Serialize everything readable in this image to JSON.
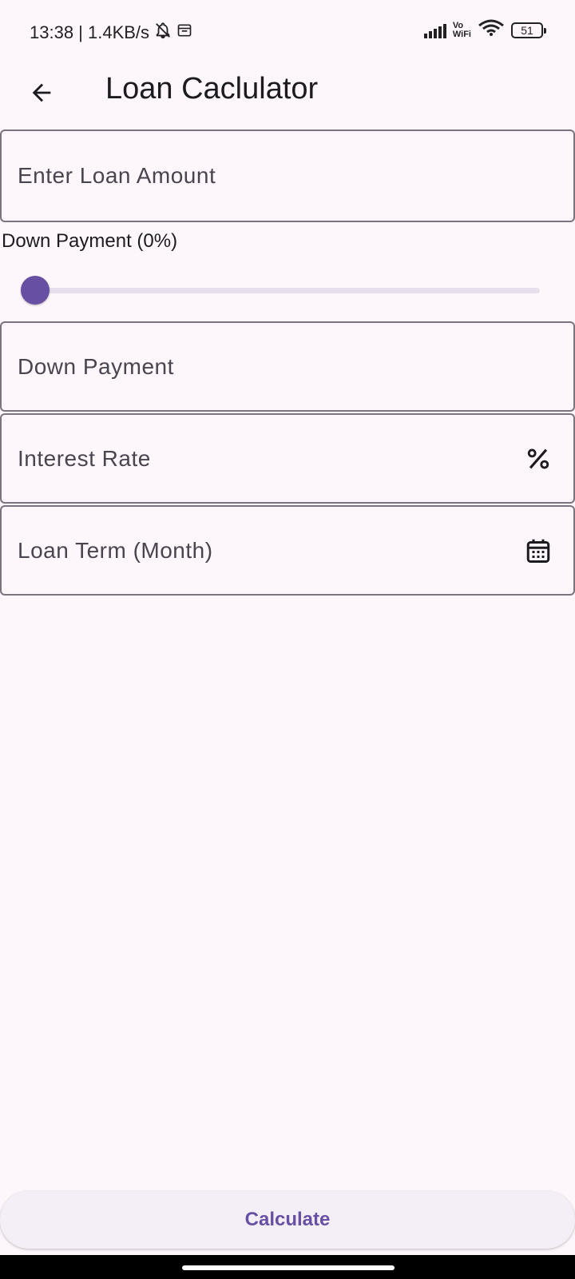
{
  "status_bar": {
    "time_speed": "13:38 | 1.4KB/s",
    "vowifi_top": "Vo",
    "vowifi_bottom": "WiFi",
    "battery": "51"
  },
  "app_bar": {
    "title": "Loan Caclulator",
    "back_icon": "arrow-back-icon"
  },
  "form": {
    "loan_amount": {
      "placeholder": "Enter Loan Amount",
      "value": ""
    },
    "down_payment_label": "Down Payment (0%)",
    "down_payment_slider": {
      "value": 0
    },
    "down_payment": {
      "placeholder": "Down Payment",
      "value": ""
    },
    "interest_rate": {
      "placeholder": "Interest Rate",
      "value": "",
      "icon": "percent-icon"
    },
    "loan_term": {
      "placeholder": "Loan Term (Month)",
      "value": "",
      "icon": "calendar-icon"
    }
  },
  "actions": {
    "calculate_label": "Calculate"
  },
  "colors": {
    "primary": "#6750a4",
    "background": "#fdf7fc",
    "outline": "#79747e"
  }
}
